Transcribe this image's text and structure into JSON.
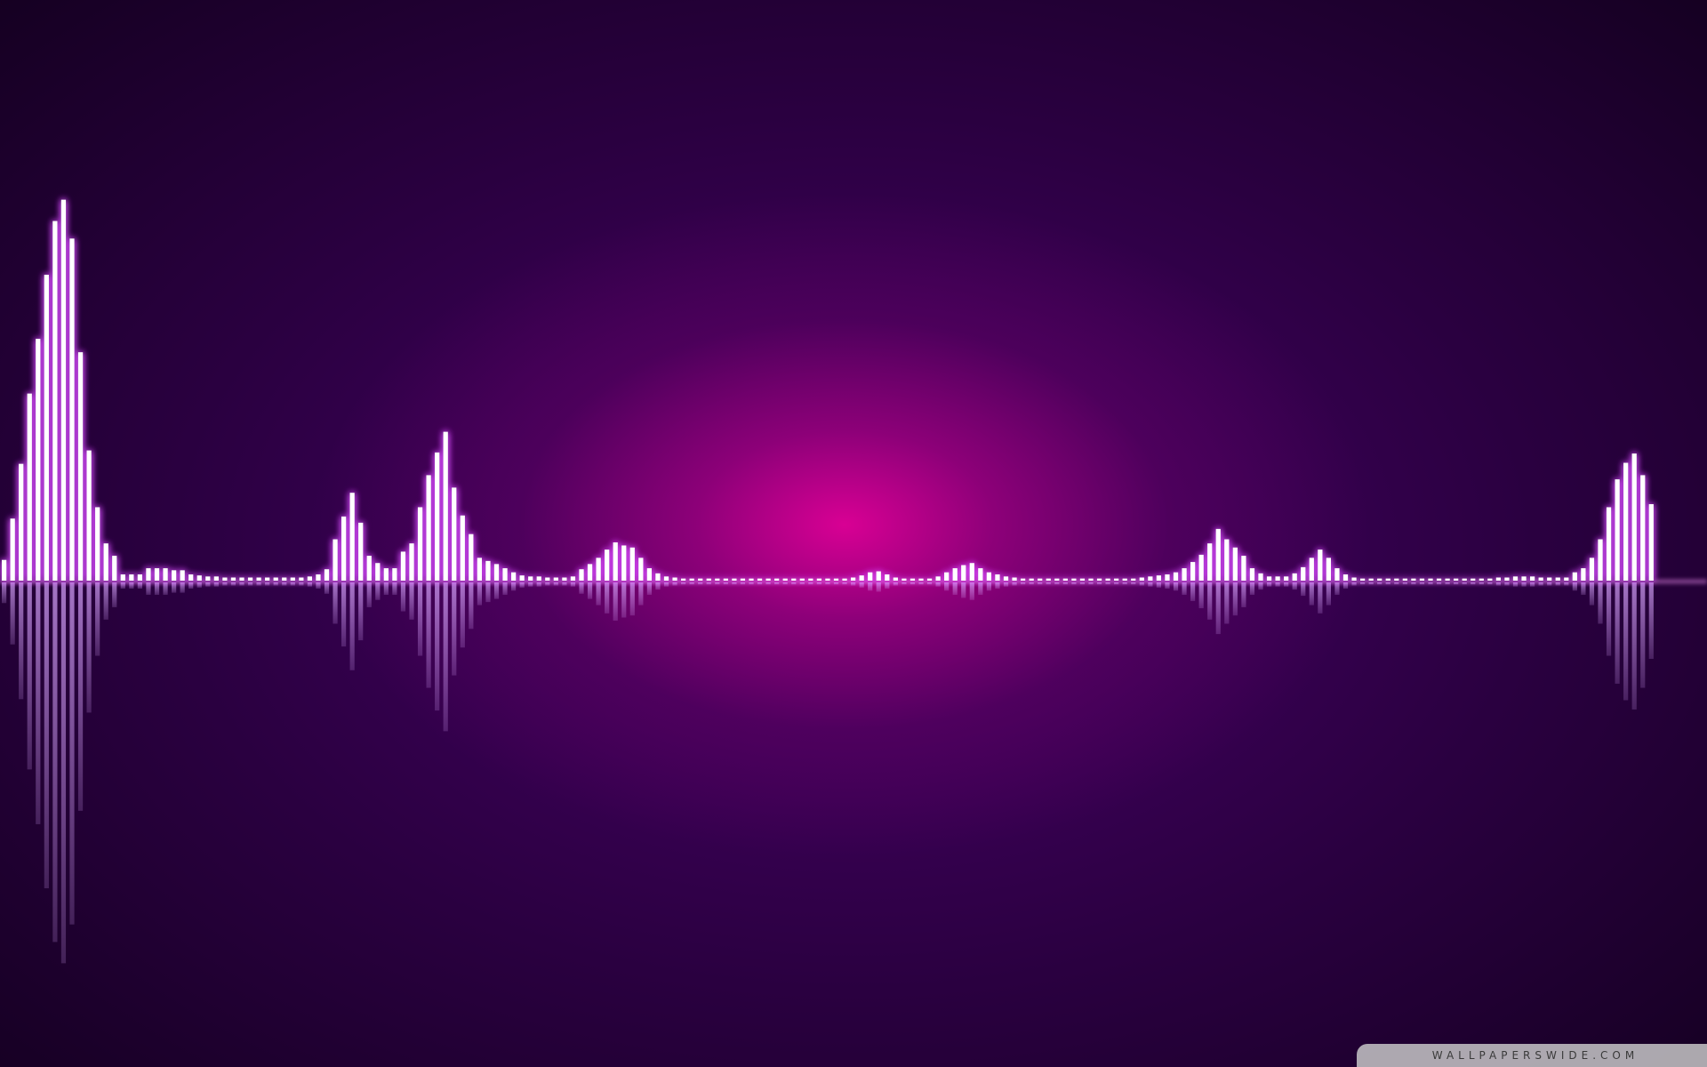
{
  "image": {
    "description_colors": {
      "background_dark": "#140020",
      "background_mid": "#4a006a",
      "center_glow": "#e00096",
      "bar_color": "#ffffff",
      "glow_color": "#d84cff"
    }
  },
  "spectrum": {
    "levels": [
      0.0541,
      0.1622,
      0.3054,
      0.4892,
      0.6324,
      0.8,
      0.9405,
      0.9962,
      0.8946,
      0.5973,
      0.3405,
      0.1919,
      0.0973,
      0.0649,
      0.0162,
      0.0162,
      0.0162,
      0.0324,
      0.0324,
      0.0324,
      0.027,
      0.027,
      0.0162,
      0.0135,
      0.0108,
      0.0108,
      0.0081,
      0.0081,
      0.0081,
      0.0081,
      0.0081,
      0.0081,
      0.0081,
      0.0081,
      0.0081,
      0.0081,
      0.0108,
      0.0162,
      0.0297,
      0.1081,
      0.1676,
      0.2297,
      0.1514,
      0.0649,
      0.0459,
      0.0324,
      0.0324,
      0.0757,
      0.0973,
      0.1919,
      0.2757,
      0.3351,
      0.3892,
      0.2432,
      0.1703,
      0.1216,
      0.0595,
      0.0514,
      0.0432,
      0.0324,
      0.0216,
      0.0135,
      0.0108,
      0.0108,
      0.0081,
      0.0081,
      0.0081,
      0.0108,
      0.0297,
      0.0432,
      0.0595,
      0.0811,
      0.1,
      0.0919,
      0.0865,
      0.0595,
      0.0324,
      0.0189,
      0.0108,
      0.0081,
      0.0054,
      0.0054,
      0.0054,
      0.0054,
      0.0054,
      0.0054,
      0.0054,
      0.0054,
      0.0054,
      0.0054,
      0.0054,
      0.0054,
      0.0054,
      0.0054,
      0.0054,
      0.0054,
      0.0054,
      0.0054,
      0.0054,
      0.0054,
      0.0081,
      0.0135,
      0.0216,
      0.0243,
      0.0162,
      0.0081,
      0.0054,
      0.0054,
      0.0054,
      0.0054,
      0.0108,
      0.0216,
      0.0324,
      0.0405,
      0.0459,
      0.0324,
      0.0216,
      0.0162,
      0.0108,
      0.0081,
      0.0054,
      0.0054,
      0.0054,
      0.0054,
      0.0054,
      0.0054,
      0.0054,
      0.0054,
      0.0054,
      0.0054,
      0.0054,
      0.0054,
      0.0054,
      0.0054,
      0.0081,
      0.0108,
      0.0135,
      0.0162,
      0.0216,
      0.0324,
      0.0486,
      0.0676,
      0.0973,
      0.1351,
      0.1081,
      0.0865,
      0.0649,
      0.0324,
      0.0189,
      0.0108,
      0.0108,
      0.0108,
      0.0189,
      0.0351,
      0.0595,
      0.0811,
      0.0595,
      0.0324,
      0.0162,
      0.0081,
      0.0054,
      0.0054,
      0.0054,
      0.0054,
      0.0054,
      0.0054,
      0.0054,
      0.0054,
      0.0054,
      0.0054,
      0.0054,
      0.0054,
      0.0054,
      0.0054,
      0.0054,
      0.0054,
      0.0081,
      0.0081,
      0.0108,
      0.0108,
      0.0108,
      0.0081,
      0.0081,
      0.0081,
      0.0081,
      0.0216,
      0.0324,
      0.0595,
      0.1081,
      0.1919,
      0.2649,
      0.3081,
      0.3324,
      0.2757,
      0.2
    ]
  },
  "watermark": {
    "text": "WALLPAPERSWIDE.COM"
  }
}
